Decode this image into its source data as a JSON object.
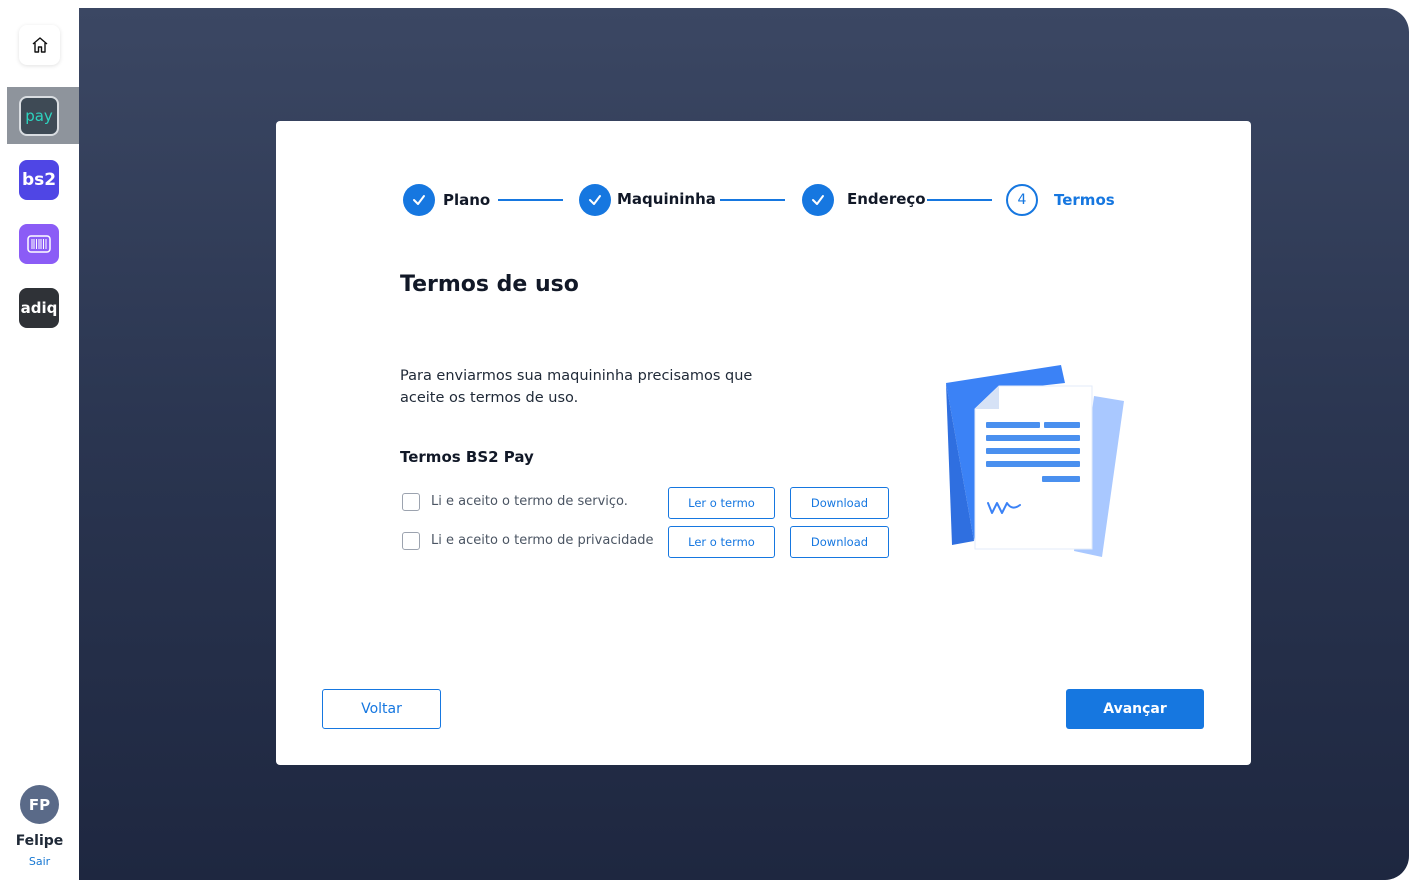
{
  "sidebar": {
    "apps": [
      {
        "label": "pay"
      },
      {
        "label": "bs2"
      },
      {
        "label": ""
      },
      {
        "label": "adiq"
      }
    ],
    "user": {
      "initials": "FP",
      "name": "Felipe",
      "logout": "Sair"
    }
  },
  "stepper": {
    "steps": [
      {
        "label": "Plano",
        "status": "done"
      },
      {
        "label": "Maquininha",
        "status": "done"
      },
      {
        "label": "Endereço",
        "status": "done"
      },
      {
        "label": "Termos",
        "number": "4",
        "status": "current"
      }
    ]
  },
  "content": {
    "title": "Termos de uso",
    "description": "Para enviarmos sua maquininha precisamos que aceite os termos de uso.",
    "section_title": "Termos BS2 Pay",
    "terms": [
      {
        "label": "Li e aceito o termo de serviço.",
        "read": "Ler o termo",
        "download": "Download"
      },
      {
        "label": "Li e aceito o termo de privacidade",
        "read": "Ler o termo",
        "download": "Download"
      }
    ]
  },
  "footer": {
    "back_label": "Voltar",
    "next_label": "Avançar"
  },
  "colors": {
    "accent": "#1677e0",
    "overlay": "#2a3550"
  }
}
